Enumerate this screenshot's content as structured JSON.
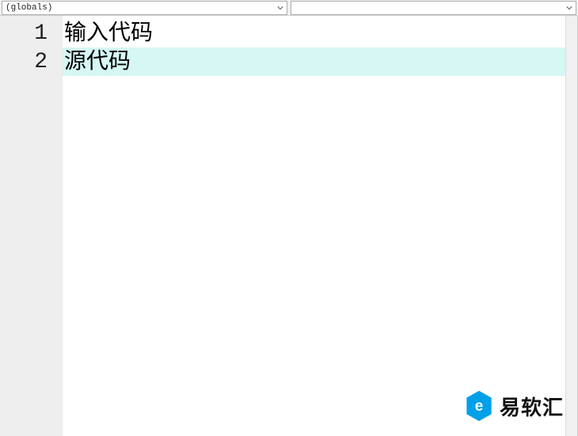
{
  "toolbar": {
    "scope_combo": {
      "value": "(globals)"
    },
    "symbol_combo": {
      "value": ""
    }
  },
  "editor": {
    "lines": [
      {
        "number": "1",
        "text": "输入代码",
        "highlighted": false
      },
      {
        "number": "2",
        "text": "源代码",
        "highlighted": true
      }
    ]
  },
  "watermark": {
    "text": "易软汇",
    "brand_color": "#00a0e9"
  }
}
